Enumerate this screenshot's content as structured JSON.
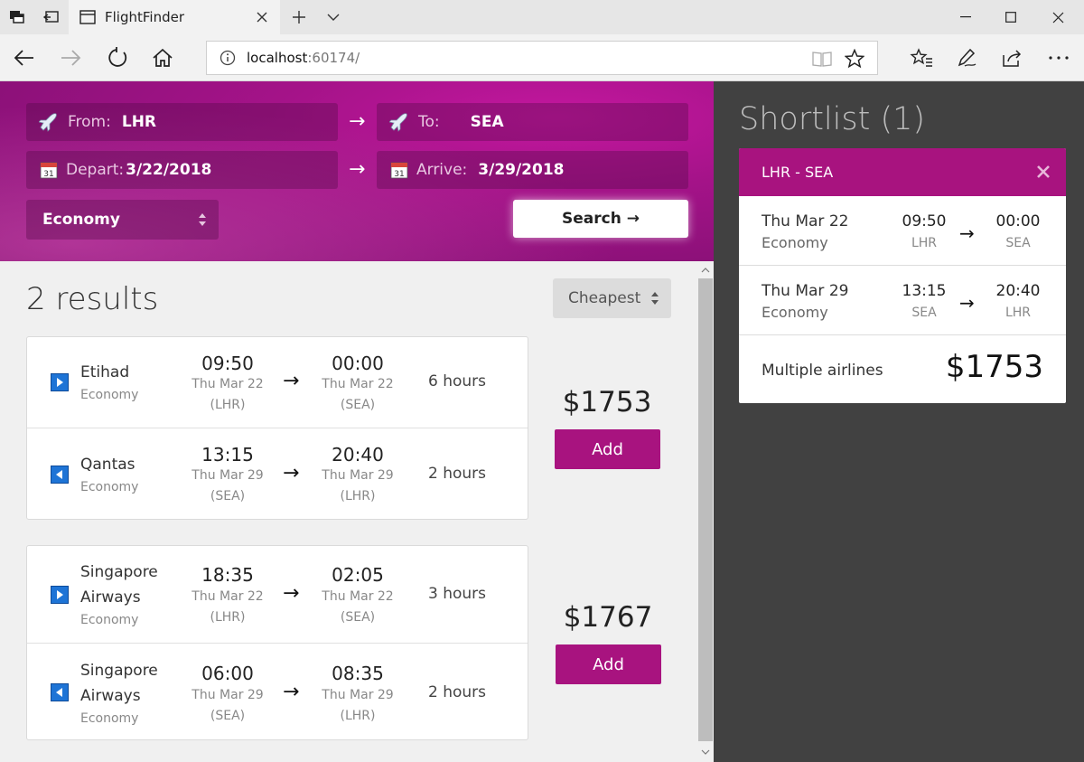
{
  "browser": {
    "tab_title": "FlightFinder",
    "url_host": "localhost",
    "url_port": ":60174/"
  },
  "search": {
    "from_label": "From:",
    "from_value": "LHR",
    "to_label": "To:",
    "to_value": "SEA",
    "depart_label": "Depart:",
    "depart_value": "3/22/2018",
    "arrive_label": "Arrive:",
    "arrive_value": "3/29/2018",
    "cabin_class": "Economy",
    "search_label": "Search →",
    "arrow": "→"
  },
  "results": {
    "title": "2 results",
    "sort": "Cheapest",
    "items": [
      {
        "price": "$1753",
        "add_label": "Add",
        "legs": [
          {
            "direction": "outbound",
            "airline": "Etihad",
            "airline2": "",
            "cabin": "Economy",
            "dep_time": "09:50",
            "dep_date": "Thu Mar 22",
            "dep_airport": "(LHR)",
            "arr_time": "00:00",
            "arr_date": "Thu Mar 22",
            "arr_airport": "(SEA)",
            "duration": "6 hours"
          },
          {
            "direction": "return",
            "airline": "Qantas",
            "airline2": "",
            "cabin": "Economy",
            "dep_time": "13:15",
            "dep_date": "Thu Mar 29",
            "dep_airport": "(SEA)",
            "arr_time": "20:40",
            "arr_date": "Thu Mar 29",
            "arr_airport": "(LHR)",
            "duration": "2 hours"
          }
        ]
      },
      {
        "price": "$1767",
        "add_label": "Add",
        "legs": [
          {
            "direction": "outbound",
            "airline": "Singapore",
            "airline2": "Airways",
            "cabin": "Economy",
            "dep_time": "18:35",
            "dep_date": "Thu Mar 22",
            "dep_airport": "(LHR)",
            "arr_time": "02:05",
            "arr_date": "Thu Mar 22",
            "arr_airport": "(SEA)",
            "duration": "3 hours"
          },
          {
            "direction": "return",
            "airline": "Singapore",
            "airline2": "Airways",
            "cabin": "Economy",
            "dep_time": "06:00",
            "dep_date": "Thu Mar 29",
            "dep_airport": "(SEA)",
            "arr_time": "08:35",
            "arr_date": "Thu Mar 29",
            "arr_airport": "(LHR)",
            "duration": "2 hours"
          }
        ]
      }
    ]
  },
  "shortlist": {
    "title": "Shortlist (1)",
    "route": "LHR - SEA",
    "rows": [
      {
        "date": "Thu Mar 22",
        "cabin": "Economy",
        "dep_time": "09:50",
        "dep_code": "LHR",
        "arr_time": "00:00",
        "arr_code": "SEA"
      },
      {
        "date": "Thu Mar 29",
        "cabin": "Economy",
        "dep_time": "13:15",
        "dep_code": "SEA",
        "arr_time": "20:40",
        "arr_code": "LHR"
      }
    ],
    "airlines": "Multiple airlines",
    "total": "$1753"
  },
  "colors": {
    "accent": "#a8137f",
    "sidebar_bg": "#414141",
    "outbound_icon": "#1e74d6"
  }
}
